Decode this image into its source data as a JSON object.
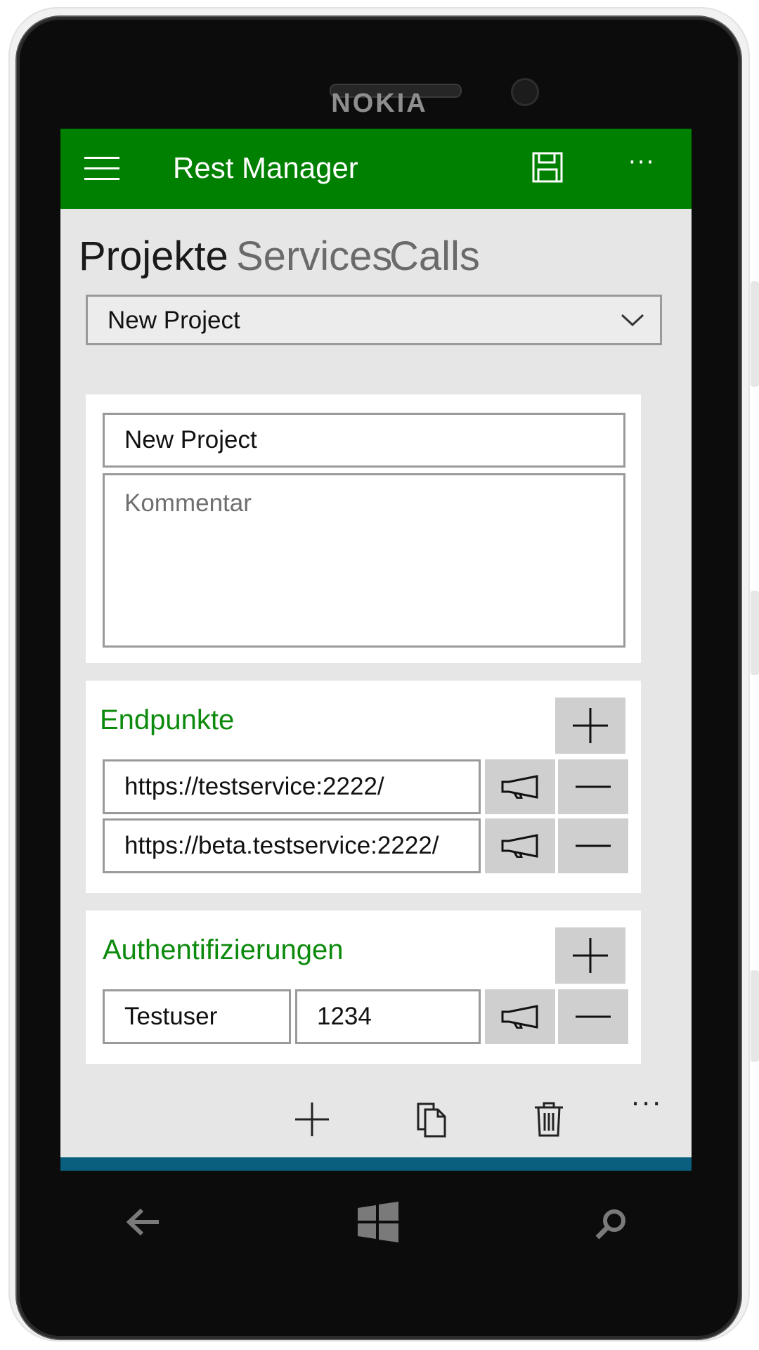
{
  "device": {
    "brand": "NOKIA"
  },
  "app_bar": {
    "title": "Rest Manager",
    "bg_color": "#008000"
  },
  "pivot": {
    "tabs": [
      {
        "label": "Projekte",
        "active": true
      },
      {
        "label": "Services",
        "active": false
      },
      {
        "label": "Calls",
        "active": false
      }
    ]
  },
  "project_select": {
    "value": "New Project"
  },
  "project_card": {
    "name_value": "New Project",
    "comment_placeholder": "Kommentar"
  },
  "endpoints": {
    "title": "Endpunkte",
    "items": [
      {
        "url": "https://testservice:2222/"
      },
      {
        "url": "https://beta.testservice:2222/"
      }
    ]
  },
  "auth": {
    "title": "Authentifizierungen",
    "items": [
      {
        "user": "Testuser",
        "password": "1234"
      }
    ]
  },
  "colors": {
    "accent": "#0c8a0c",
    "bottom_bar": "#0b5f7e"
  },
  "icons": [
    "hamburger-icon",
    "save-icon",
    "more-icon",
    "chevron-down-icon",
    "plus-icon",
    "megaphone-icon",
    "minus-icon",
    "copy-icon",
    "delete-icon",
    "back-icon",
    "windows-icon",
    "search-icon"
  ]
}
